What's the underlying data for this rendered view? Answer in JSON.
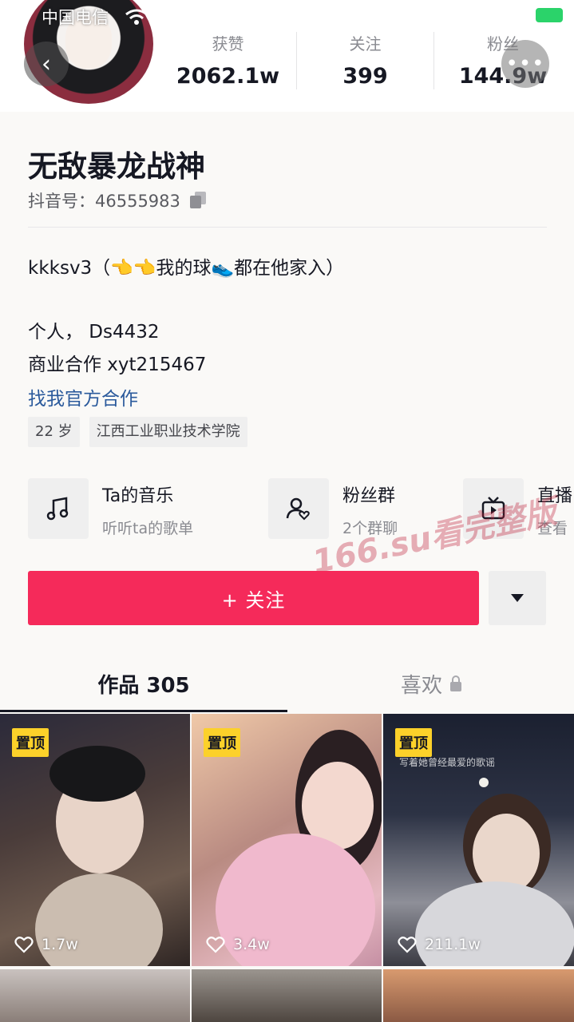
{
  "status": {
    "carrier": "中国电信"
  },
  "profile": {
    "stats": [
      {
        "label": "获赞",
        "value": "2062.1w"
      },
      {
        "label": "关注",
        "value": "399"
      },
      {
        "label": "粉丝",
        "value": "144.9w"
      }
    ],
    "name": "无敌暴龙战神",
    "douyin_id": "抖音号：46555983",
    "bio_line1": "kkksv3（👈👈我的球👟都在他家入）",
    "bio_line2": "个人， Ds4432",
    "bio_line3": "商业合作 xyt215467",
    "bio_link": "找我官方合作",
    "tags": [
      "22 岁",
      "江西工业职业技术学院"
    ]
  },
  "cards": [
    {
      "icon": "music-note-icon",
      "title": "Ta的音乐",
      "subtitle": "听听ta的歌单"
    },
    {
      "icon": "fan-group-icon",
      "title": "粉丝群",
      "subtitle": "2个群聊"
    },
    {
      "icon": "live-tv-icon",
      "title": "直播",
      "subtitle": "查看"
    }
  ],
  "actions": {
    "follow_label": "+ 关注"
  },
  "watermark": "166.su看完整版",
  "tabs": {
    "works": "作品 305",
    "likes": "喜欢"
  },
  "videos": [
    {
      "pinned_label": "置顶",
      "likes": "1.7w"
    },
    {
      "pinned_label": "置顶",
      "likes": "3.4w"
    },
    {
      "pinned_label": "置顶",
      "likes": "211.1w",
      "caption": "写着她曾经最爱的歌谣"
    }
  ],
  "colors": {
    "follow_button": "#f52a5a",
    "pin_badge": "#fcd12a",
    "link": "#2b5a9c"
  }
}
